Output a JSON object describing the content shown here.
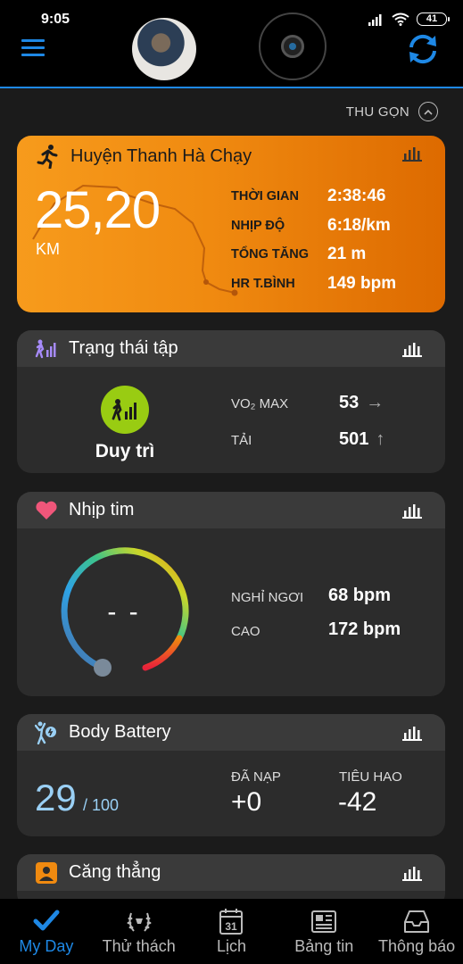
{
  "status_bar": {
    "time": "9:05",
    "battery": "41"
  },
  "header": {
    "collapse_label": "THU GỌN"
  },
  "activity": {
    "title": "Huyện Thanh Hà Chạy",
    "distance": "25,20",
    "distance_unit": "KM",
    "stats": [
      {
        "label": "THỜI GIAN",
        "value": "2:38:46"
      },
      {
        "label": "NHỊP ĐỘ",
        "value": "6:18/km"
      },
      {
        "label": "TỔNG TĂNG",
        "value": "21 m"
      },
      {
        "label": "HR T.BÌNH",
        "value": "149 bpm"
      }
    ]
  },
  "training_status": {
    "title": "Trạng thái tập",
    "status": "Duy trì",
    "vo2_label": "VO₂ MAX",
    "vo2_value": "53",
    "load_label": "TẢI",
    "load_value": "501"
  },
  "heart_rate": {
    "title": "Nhịp tim",
    "current": "- -",
    "resting_label": "NGHỈ NGƠI",
    "resting_value": "68 bpm",
    "high_label": "CAO",
    "high_value": "172 bpm"
  },
  "body_battery": {
    "title": "Body Battery",
    "value": "29",
    "total": "/ 100",
    "charged_label": "ĐÃ NẠP",
    "charged_value": "+0",
    "drained_label": "TIÊU HAO",
    "drained_value": "-42"
  },
  "stress": {
    "title": "Căng thẳng"
  },
  "nav": [
    {
      "label": "My Day",
      "icon": "check-icon"
    },
    {
      "label": "Thử thách",
      "icon": "laurel-icon"
    },
    {
      "label": "Lịch",
      "icon": "calendar-icon",
      "day": "31"
    },
    {
      "label": "Bảng tin",
      "icon": "newsfeed-icon"
    },
    {
      "label": "Thông báo",
      "icon": "inbox-icon"
    }
  ],
  "colors": {
    "accent": "#1e88e5",
    "activity_orange": "#f08a10",
    "training_green": "#99cc12",
    "battery_blue": "#9ad0f5"
  }
}
